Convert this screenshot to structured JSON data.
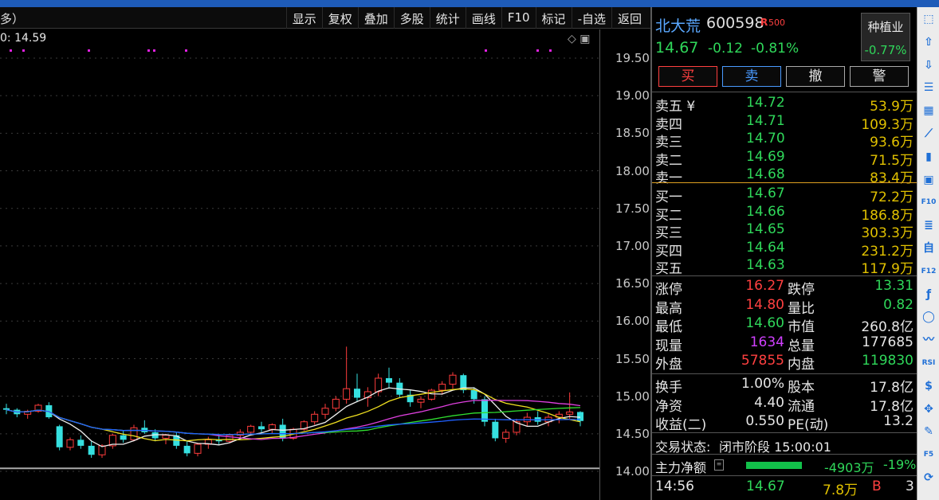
{
  "toolbar": {
    "left_text": "多）",
    "buttons": [
      "显示",
      "复权",
      "叠加",
      "多股",
      "统计",
      "画线",
      "F10",
      "标记",
      "-自选",
      "返回"
    ]
  },
  "chart": {
    "ma_label": "0: 14.59",
    "y_ticks": [
      "19.50",
      "19.00",
      "18.50",
      "18.00",
      "17.50",
      "17.00",
      "16.50",
      "16.00",
      "15.50",
      "15.00",
      "14.50",
      "14.00"
    ]
  },
  "chart_data": {
    "type": "candlestick",
    "ylim": [
      14.0,
      19.5
    ],
    "candles": [
      [
        14.84,
        14.9,
        14.76,
        14.82
      ],
      [
        14.82,
        14.84,
        14.72,
        14.76
      ],
      [
        14.76,
        14.82,
        14.7,
        14.8
      ],
      [
        14.8,
        14.9,
        14.78,
        14.88
      ],
      [
        14.88,
        14.92,
        14.7,
        14.72
      ],
      [
        14.6,
        14.62,
        14.28,
        14.32
      ],
      [
        14.32,
        14.45,
        14.28,
        14.42
      ],
      [
        14.42,
        14.48,
        14.3,
        14.34
      ],
      [
        14.34,
        14.4,
        14.18,
        14.22
      ],
      [
        14.22,
        14.36,
        14.18,
        14.34
      ],
      [
        14.34,
        14.5,
        14.3,
        14.48
      ],
      [
        14.48,
        14.55,
        14.38,
        14.42
      ],
      [
        14.42,
        14.62,
        14.4,
        14.58
      ],
      [
        14.58,
        14.68,
        14.5,
        14.52
      ],
      [
        14.52,
        14.56,
        14.4,
        14.44
      ],
      [
        14.44,
        14.5,
        14.36,
        14.48
      ],
      [
        14.48,
        14.52,
        14.3,
        14.34
      ],
      [
        14.34,
        14.4,
        14.2,
        14.24
      ],
      [
        14.24,
        14.38,
        14.2,
        14.36
      ],
      [
        14.36,
        14.46,
        14.3,
        14.42
      ],
      [
        14.42,
        14.48,
        14.36,
        14.4
      ],
      [
        14.4,
        14.5,
        14.38,
        14.48
      ],
      [
        14.48,
        14.56,
        14.44,
        14.52
      ],
      [
        14.52,
        14.62,
        14.48,
        14.6
      ],
      [
        14.6,
        14.66,
        14.52,
        14.56
      ],
      [
        14.56,
        14.64,
        14.5,
        14.62
      ],
      [
        14.62,
        14.7,
        14.4,
        14.44
      ],
      [
        14.44,
        14.58,
        14.42,
        14.56
      ],
      [
        14.56,
        14.68,
        14.54,
        14.66
      ],
      [
        14.66,
        14.8,
        14.62,
        14.76
      ],
      [
        14.76,
        14.9,
        14.7,
        14.84
      ],
      [
        14.84,
        15.0,
        14.8,
        14.96
      ],
      [
        14.96,
        15.66,
        14.9,
        15.1
      ],
      [
        15.1,
        15.3,
        14.92,
        14.98
      ],
      [
        14.98,
        15.12,
        14.86,
        15.06
      ],
      [
        15.06,
        15.3,
        15.0,
        15.24
      ],
      [
        15.24,
        15.38,
        15.1,
        15.18
      ],
      [
        15.18,
        15.24,
        14.98,
        15.02
      ],
      [
        15.02,
        15.08,
        14.86,
        14.92
      ],
      [
        14.92,
        15.0,
        14.84,
        14.96
      ],
      [
        14.96,
        15.1,
        14.94,
        15.08
      ],
      [
        15.08,
        15.2,
        15.02,
        15.16
      ],
      [
        15.16,
        15.32,
        15.1,
        15.28
      ],
      [
        15.28,
        15.3,
        15.04,
        15.08
      ],
      [
        15.08,
        15.12,
        14.9,
        14.96
      ],
      [
        14.96,
        15.0,
        14.6,
        14.66
      ],
      [
        14.66,
        14.7,
        14.4,
        14.44
      ],
      [
        14.44,
        14.56,
        14.38,
        14.52
      ],
      [
        14.52,
        14.7,
        14.48,
        14.66
      ],
      [
        14.66,
        14.78,
        14.6,
        14.72
      ],
      [
        14.72,
        14.8,
        14.62,
        14.66
      ],
      [
        14.66,
        14.76,
        14.6,
        14.72
      ],
      [
        14.72,
        14.8,
        14.64,
        14.76
      ],
      [
        14.76,
        15.05,
        14.7,
        14.79
      ],
      [
        14.79,
        14.8,
        14.6,
        14.67
      ]
    ]
  },
  "quote": {
    "name": "北大荒",
    "code": "600598",
    "badge": "R",
    "badge_num": "500",
    "price": "14.67",
    "change": "-0.12",
    "change_pct": "-0.81%",
    "sector_name": "种植业",
    "sector_change": "-0.77%"
  },
  "trade_buttons": {
    "buy": "买",
    "sell": "卖",
    "cancel": "撤",
    "alert": "警"
  },
  "order_book": {
    "asks": [
      {
        "label": "卖五 ¥",
        "price": "14.72",
        "vol": "53.9万"
      },
      {
        "label": "卖四",
        "price": "14.71",
        "vol": "109.3万"
      },
      {
        "label": "卖三",
        "price": "14.70",
        "vol": "93.6万"
      },
      {
        "label": "卖二",
        "price": "14.69",
        "vol": "71.5万"
      },
      {
        "label": "卖一",
        "price": "14.68",
        "vol": "83.4万"
      }
    ],
    "bids": [
      {
        "label": "买一",
        "price": "14.67",
        "vol": "72.2万"
      },
      {
        "label": "买二",
        "price": "14.66",
        "vol": "186.8万"
      },
      {
        "label": "买三",
        "price": "14.65",
        "vol": "303.3万"
      },
      {
        "label": "买四",
        "price": "14.64",
        "vol": "231.2万"
      },
      {
        "label": "买五",
        "price": "14.63",
        "vol": "117.9万"
      }
    ]
  },
  "stats": [
    {
      "l1": "涨停",
      "v1": "16.27",
      "l2": "跌停",
      "v2": "13.31"
    },
    {
      "l1": "最高",
      "v1": "14.80",
      "l2": "量比",
      "v2": "0.82"
    },
    {
      "l1": "最低",
      "v1": "14.60",
      "l2": "市值",
      "v2": "260.8亿"
    },
    {
      "l1": "现量",
      "v1": "1634",
      "l2": "总量",
      "v2": "177685"
    },
    {
      "l1": "外盘",
      "v1": "57855",
      "l2": "内盘",
      "v2": "119830"
    }
  ],
  "stats2": [
    {
      "l1": "换手",
      "v1": "1.00%",
      "l2": "股本",
      "v2": "17.8亿"
    },
    {
      "l1": "净资",
      "v1": "4.40",
      "l2": "流通",
      "v2": "17.8亿"
    },
    {
      "l1": "收益(二)",
      "v1": "0.550",
      "l2": "PE(动)",
      "v2": "13.2"
    }
  ],
  "status": {
    "label": "交易状态:",
    "value": "闭市阶段 15:00:01"
  },
  "main_flow": {
    "label": "主力净额",
    "amount": "-4903万",
    "pct": "-19%"
  },
  "tick": {
    "time": "14:56",
    "price": "14.67",
    "vol": "7.8万",
    "side": "B",
    "count": "3"
  },
  "sidebar_icons": [
    "expand-icon",
    "arrow-up-icon",
    "arrow-down-icon",
    "list-icon",
    "table-icon",
    "line-chart-icon",
    "candle-icon",
    "window-icon",
    "f10-icon",
    "news-icon",
    "self-icon",
    "f12-icon",
    "fx-icon",
    "circle-icon",
    "wave-icon",
    "rsi-icon",
    "dollar-icon",
    "move-icon",
    "pen-icon",
    "f5-icon",
    "refresh-icon"
  ]
}
